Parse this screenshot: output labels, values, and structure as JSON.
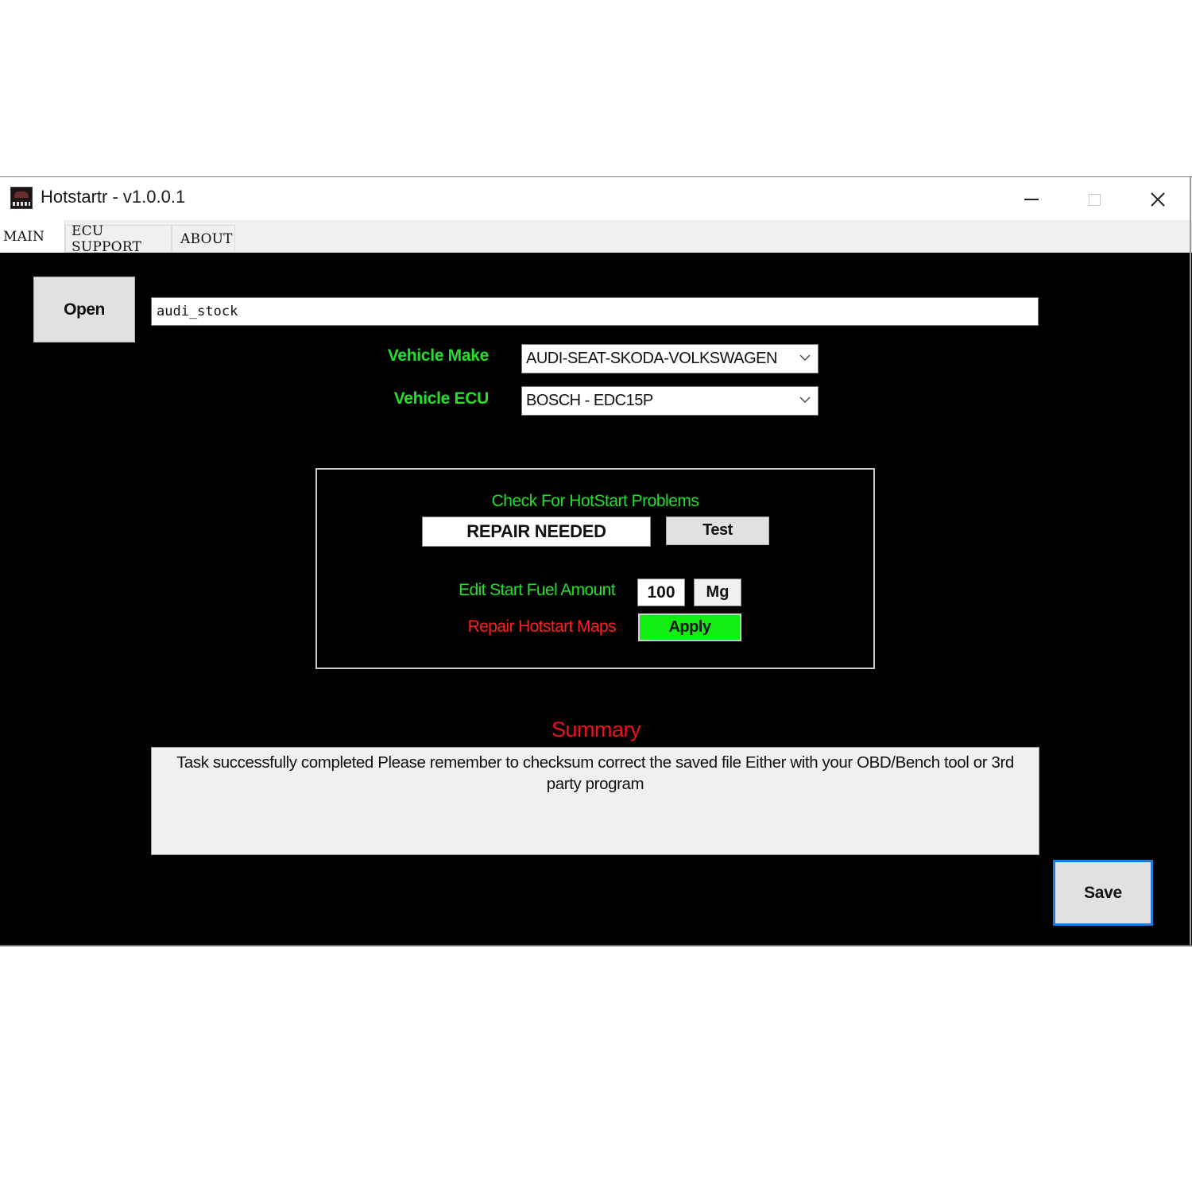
{
  "window": {
    "title": "Hotstartr - v1.0.0.1",
    "app_icon": "app-logo-icon",
    "controls": {
      "minimize_icon": "minimize-icon",
      "maximize_icon": "maximize-icon",
      "close_icon": "close-icon"
    }
  },
  "tabs": [
    {
      "label": "MAIN",
      "active": true
    },
    {
      "label": "ECU SUPPORT",
      "active": false
    },
    {
      "label": "ABOUT",
      "active": false
    }
  ],
  "main": {
    "open_button": "Open",
    "file_name": "audi_stock",
    "vehicle_make": {
      "label": "Vehicle Make",
      "selected": "AUDI-SEAT-SKODA-VOLKSWAGEN"
    },
    "vehicle_ecu": {
      "label": "Vehicle ECU",
      "selected": "BOSCH - EDC15P"
    },
    "hotstart_check": {
      "title": "Check For HotStart Problems",
      "status": "REPAIR NEEDED",
      "test_button": "Test",
      "fuel_label": "Edit Start Fuel Amount",
      "fuel_value": "100",
      "fuel_unit": "Mg",
      "repair_label": "Repair Hotstart Maps",
      "apply_button": "Apply"
    },
    "summary": {
      "title": "Summary",
      "text": "Task successfully completed Please remember to checksum correct the saved file Either with your OBD/Bench tool or 3rd party program"
    },
    "save_button": "Save"
  },
  "colors": {
    "background": "#000000",
    "label_green": "#22e02a",
    "label_red": "#ff1f1f",
    "summary_red": "#e8141c",
    "apply_green": "#12ee12",
    "save_focus_blue": "#1e7ad8"
  }
}
